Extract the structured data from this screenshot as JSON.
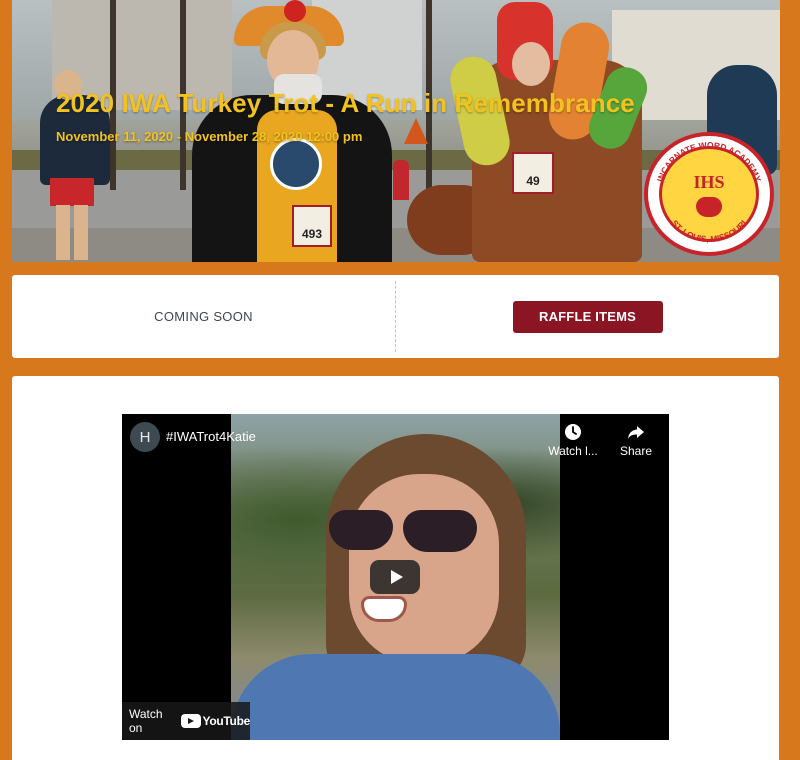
{
  "hero": {
    "title": "2020 IWA Turkey Trot - A Run in Remembrance",
    "date": "November 11, 2020 - November 28, 2020 12:00 pm",
    "seal_text_top": "INCARNATE WORD ACADEMY",
    "seal_text_bottom": "ST. LOUIS, MISSOURI",
    "seal_monogram": "IHS",
    "bib_number": "493",
    "bib_number_2": "49"
  },
  "actions": {
    "coming_soon": "COMING SOON",
    "raffle_label": "RAFFLE ITEMS",
    "raffle_color": "#8b1523"
  },
  "video": {
    "channel_initial": "H",
    "title": "#IWATrot4Katie",
    "watch_later": "Watch l...",
    "share": "Share",
    "watch_on": "Watch on",
    "youtube": "YouTube",
    "play_icon": "play-icon"
  },
  "colors": {
    "page_bg": "#d8781c",
    "title_yellow": "#f2c320",
    "panel_bg": "#ffffff"
  }
}
